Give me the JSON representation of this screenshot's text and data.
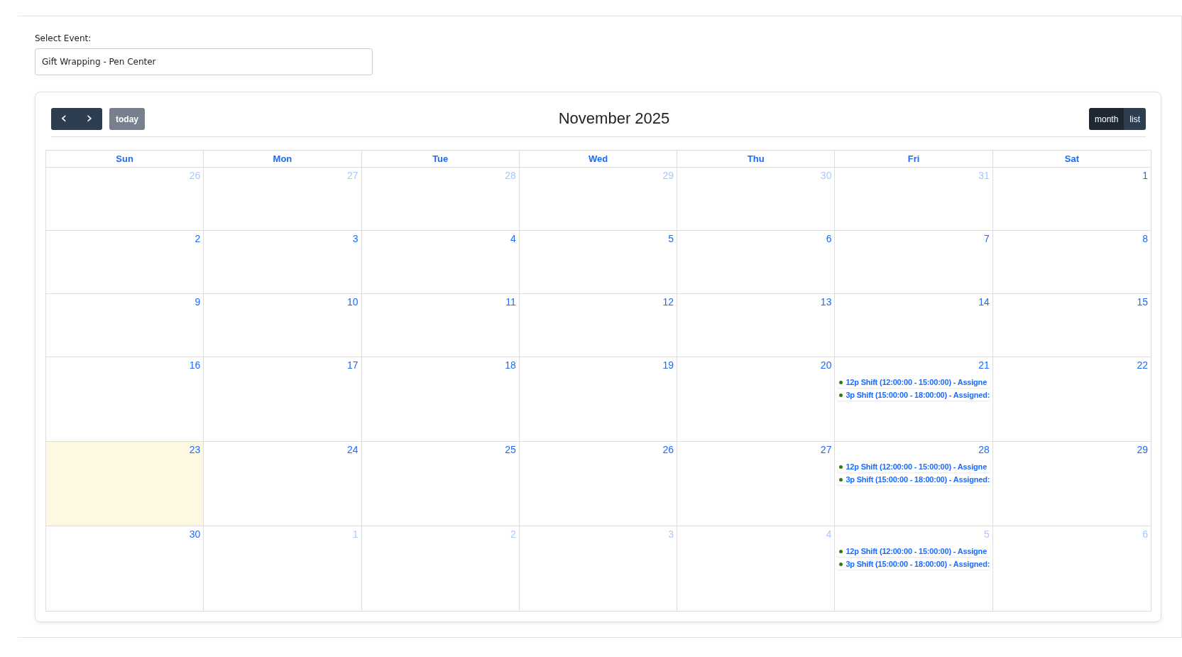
{
  "select_event": {
    "label": "Select Event:",
    "value": "Gift Wrapping - Pen Center"
  },
  "toolbar": {
    "prev": "‹",
    "next": "›",
    "today": "today",
    "title": "November 2025",
    "views": [
      {
        "label": "month",
        "selected": true
      },
      {
        "label": "list",
        "selected": false
      }
    ]
  },
  "weekdays": [
    "Sun",
    "Mon",
    "Tue",
    "Wed",
    "Thu",
    "Fri",
    "Sat"
  ],
  "weeks": [
    [
      {
        "day": "26",
        "other_month": true,
        "today": false
      },
      {
        "day": "27",
        "other_month": true,
        "today": false
      },
      {
        "day": "28",
        "other_month": true,
        "today": false
      },
      {
        "day": "29",
        "other_month": true,
        "today": false
      },
      {
        "day": "30",
        "other_month": true,
        "today": false
      },
      {
        "day": "31",
        "other_month": true,
        "today": false
      },
      {
        "day": "1",
        "other_month": false,
        "today": false
      }
    ],
    [
      {
        "day": "2",
        "other_month": false,
        "today": false
      },
      {
        "day": "3",
        "other_month": false,
        "today": false
      },
      {
        "day": "4",
        "other_month": false,
        "today": false
      },
      {
        "day": "5",
        "other_month": false,
        "today": false
      },
      {
        "day": "6",
        "other_month": false,
        "today": false
      },
      {
        "day": "7",
        "other_month": false,
        "today": false
      },
      {
        "day": "8",
        "other_month": false,
        "today": false
      }
    ],
    [
      {
        "day": "9",
        "other_month": false,
        "today": false
      },
      {
        "day": "10",
        "other_month": false,
        "today": false
      },
      {
        "day": "11",
        "other_month": false,
        "today": false
      },
      {
        "day": "12",
        "other_month": false,
        "today": false
      },
      {
        "day": "13",
        "other_month": false,
        "today": false
      },
      {
        "day": "14",
        "other_month": false,
        "today": false
      },
      {
        "day": "15",
        "other_month": false,
        "today": false
      }
    ],
    [
      {
        "day": "16",
        "other_month": false,
        "today": false
      },
      {
        "day": "17",
        "other_month": false,
        "today": false
      },
      {
        "day": "18",
        "other_month": false,
        "today": false
      },
      {
        "day": "19",
        "other_month": false,
        "today": false
      },
      {
        "day": "20",
        "other_month": false,
        "today": false
      },
      {
        "day": "21",
        "other_month": false,
        "today": false,
        "events": [
          {
            "title": "12p Shift (12:00:00 - 15:00:00) - Assigne",
            "color": "#2e7d0f"
          },
          {
            "title": "3p Shift (15:00:00 - 18:00:00) - Assigned:",
            "color": "#2e7d0f"
          }
        ]
      },
      {
        "day": "22",
        "other_month": false,
        "today": false
      }
    ],
    [
      {
        "day": "23",
        "other_month": false,
        "today": true
      },
      {
        "day": "24",
        "other_month": false,
        "today": false
      },
      {
        "day": "25",
        "other_month": false,
        "today": false
      },
      {
        "day": "26",
        "other_month": false,
        "today": false
      },
      {
        "day": "27",
        "other_month": false,
        "today": false
      },
      {
        "day": "28",
        "other_month": false,
        "today": false,
        "events": [
          {
            "title": "12p Shift (12:00:00 - 15:00:00) - Assigne",
            "color": "#2e7d0f"
          },
          {
            "title": "3p Shift (15:00:00 - 18:00:00) - Assigned:",
            "color": "#2e7d0f"
          }
        ]
      },
      {
        "day": "29",
        "other_month": false,
        "today": false
      }
    ],
    [
      {
        "day": "30",
        "other_month": false,
        "today": false
      },
      {
        "day": "1",
        "other_month": true,
        "today": false
      },
      {
        "day": "2",
        "other_month": true,
        "today": false
      },
      {
        "day": "3",
        "other_month": true,
        "today": false
      },
      {
        "day": "4",
        "other_month": true,
        "today": false
      },
      {
        "day": "5",
        "other_month": true,
        "today": false,
        "events": [
          {
            "title": "12p Shift (12:00:00 - 15:00:00) - Assigne",
            "color": "#2e7d0f"
          },
          {
            "title": "3p Shift (15:00:00 - 18:00:00) - Assigned:",
            "color": "#2e7d0f"
          }
        ]
      },
      {
        "day": "6",
        "other_month": true,
        "today": false
      }
    ]
  ]
}
